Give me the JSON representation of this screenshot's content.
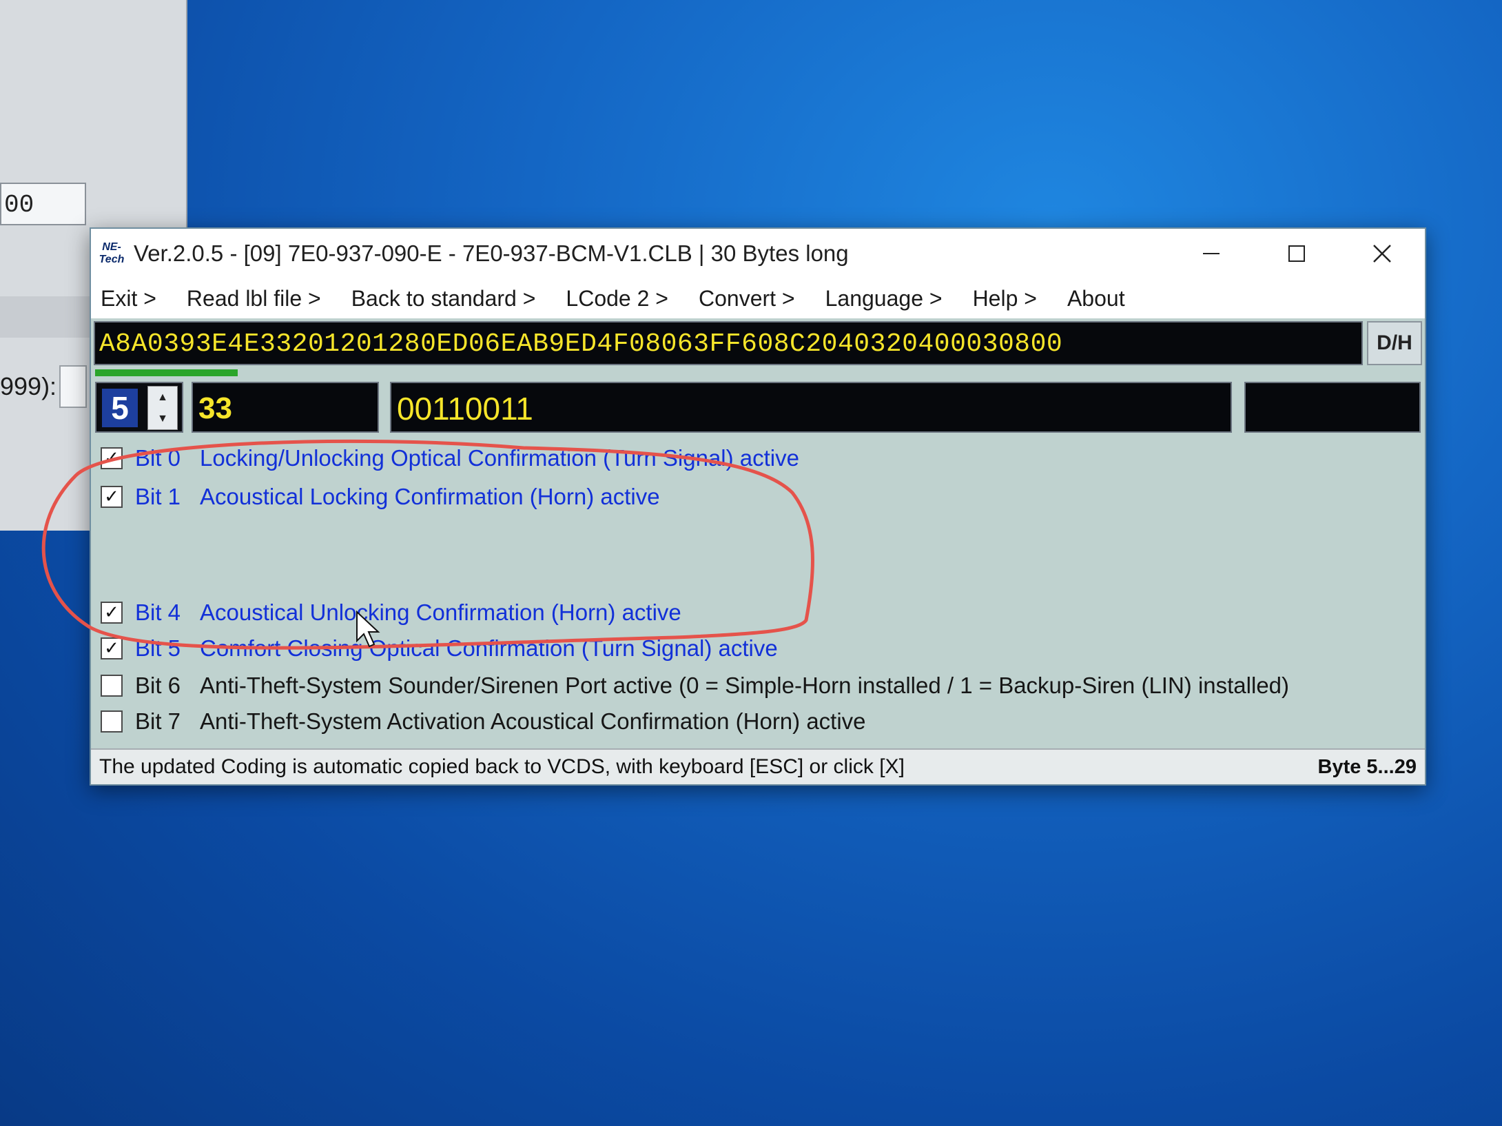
{
  "background_window": {
    "field_value": "00",
    "label_text": "999):"
  },
  "window": {
    "title": "Ver.2.0.5 - [09] 7E0-937-090-E - 7E0-937-BCM-V1.CLB | 30 Bytes long",
    "logo_text_line1": "NE-",
    "logo_text_line2": "Tech"
  },
  "menu": {
    "items": [
      {
        "label": "Exit >"
      },
      {
        "label": "Read lbl file >"
      },
      {
        "label": "Back to standard >"
      },
      {
        "label": "LCode 2 >"
      },
      {
        "label": "Convert >"
      },
      {
        "label": "Language >"
      },
      {
        "label": "Help >"
      },
      {
        "label": "About"
      }
    ]
  },
  "coding": {
    "value": "A8A0393E4E33201201280ED06EAB9ED4F08063FF608C2040320400030800",
    "dh_label": "D/H",
    "progress_fraction": 0.11
  },
  "byte": {
    "index": "5",
    "hex": "33",
    "binary": "00110011",
    "extra": ""
  },
  "bits": [
    {
      "bit": "Bit 0",
      "label": "Locking/Unlocking Optical Confirmation (Turn Signal) active",
      "checked": true,
      "highlight": true
    },
    {
      "bit": "Bit 1",
      "label": "Acoustical Locking Confirmation (Horn) active",
      "checked": true,
      "highlight": true
    },
    {
      "bit": "Bit 4",
      "label": "Acoustical Unlocking Confirmation (Horn) active",
      "checked": true,
      "highlight": true
    },
    {
      "bit": "Bit 5",
      "label": "Comfort Closing Optical Confirmation (Turn Signal) active",
      "checked": true,
      "highlight": true
    },
    {
      "bit": "Bit 6",
      "label": "Anti-Theft-System Sounder/Sirenen Port active (0 = Simple-Horn installed / 1 = Backup-Siren (LIN) installed)",
      "checked": false,
      "highlight": false
    },
    {
      "bit": "Bit 7",
      "label": "Anti-Theft-System Activation Acoustical Confirmation (Horn) active",
      "checked": false,
      "highlight": false
    }
  ],
  "status": {
    "message": "The updated Coding is automatic copied back to VCDS, with keyboard [ESC] or click [X]",
    "range": "Byte 5...29"
  },
  "colors": {
    "annotation": "#e5534b",
    "field_text": "#f6e52a",
    "active_bit_text": "#1230d8"
  }
}
